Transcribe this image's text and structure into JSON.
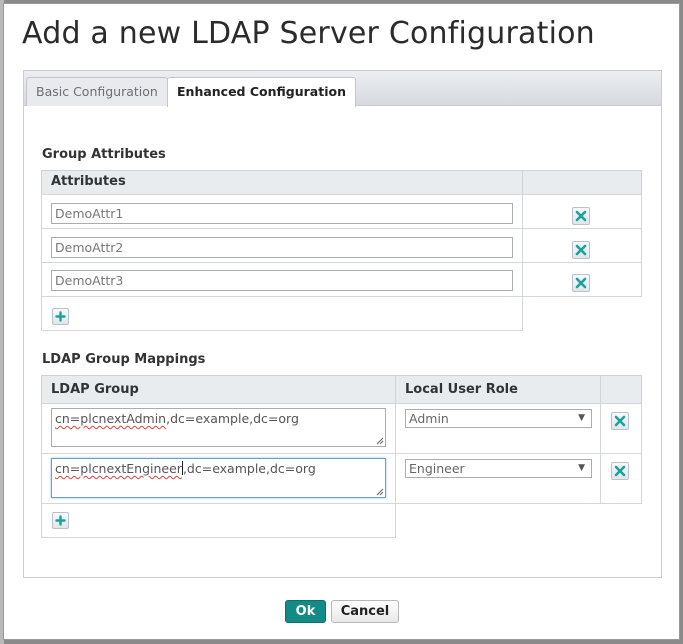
{
  "dialog": {
    "title": "Add a new LDAP Server Configuration"
  },
  "tabs": [
    {
      "label": "Basic Configuration",
      "active": false
    },
    {
      "label": "Enhanced Configuration",
      "active": true
    }
  ],
  "group_attributes": {
    "section_title": "Group Attributes",
    "column_header": "Attributes",
    "rows": [
      {
        "value": "DemoAttr1"
      },
      {
        "value": "DemoAttr2"
      },
      {
        "value": "DemoAttr3"
      }
    ]
  },
  "group_mappings": {
    "section_title": "LDAP Group Mappings",
    "columns": [
      "LDAP Group",
      "Local User Role"
    ],
    "rows": [
      {
        "ldap_group_prefix": "cn=",
        "ldap_group_name": "plcnextAdmin",
        "ldap_group_suffix": ",dc=example,dc=org",
        "role": "Admin"
      },
      {
        "ldap_group_prefix": "cn=",
        "ldap_group_name": "plcnextEngineer",
        "ldap_group_suffix": ",dc=example,dc=org",
        "role": "Engineer"
      }
    ]
  },
  "footer": {
    "ok_label": "Ok",
    "cancel_label": "Cancel"
  },
  "colors": {
    "accent": "#128a85",
    "remove_icon": "#1aa39b",
    "header_bg": "#e9ecef"
  },
  "icons": {
    "remove": "close-x-icon",
    "add": "plus-icon",
    "dropdown": "triangle-down-icon"
  }
}
